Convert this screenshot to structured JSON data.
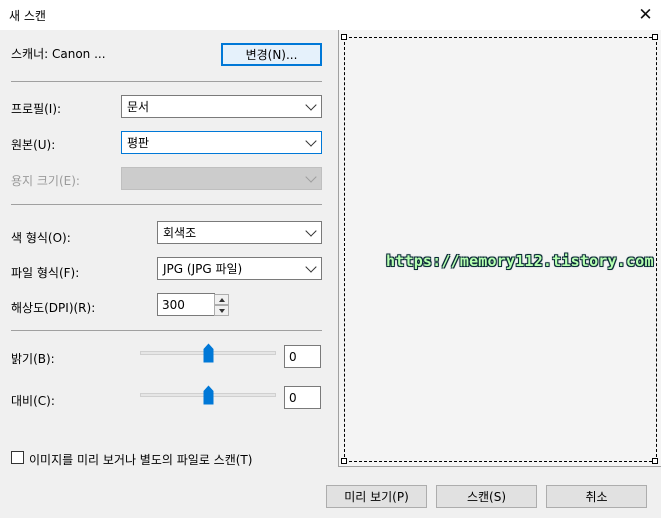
{
  "window": {
    "title": "새 스캔",
    "close_glyph": "✕"
  },
  "scanner": {
    "label": "스캐너: Canon ...",
    "change_button": "변경(N)..."
  },
  "settings": {
    "profile": {
      "label": "프로필(I):",
      "value": "문서"
    },
    "source": {
      "label": "원본(U):",
      "value": "평판"
    },
    "paper_size": {
      "label": "용지 크기(E):",
      "value": ""
    },
    "color_format": {
      "label": "색 형식(O):",
      "value": "회색조"
    },
    "file_type": {
      "label": "파일 형식(F):",
      "value": "JPG (JPG 파일)"
    },
    "resolution": {
      "label": "해상도(DPI)(R):",
      "value": "300"
    },
    "brightness": {
      "label": "밝기(B):",
      "value": "0",
      "level_fraction": 0.5
    },
    "contrast": {
      "label": "대비(C):",
      "value": "0",
      "level_fraction": 0.5
    },
    "separate_files": {
      "label": "이미지를 미리 보거나 별도의 파일로 스캔(T)",
      "checked": false
    }
  },
  "preview_area": {
    "watermark": "https://memory112.tistory.com"
  },
  "footer": {
    "preview_button": "미리 보기(P)",
    "scan_button": "스캔(S)",
    "cancel_button": "취소"
  },
  "colors": {
    "accent": "#0078d7",
    "dialog_bg": "#f0f0f0"
  }
}
